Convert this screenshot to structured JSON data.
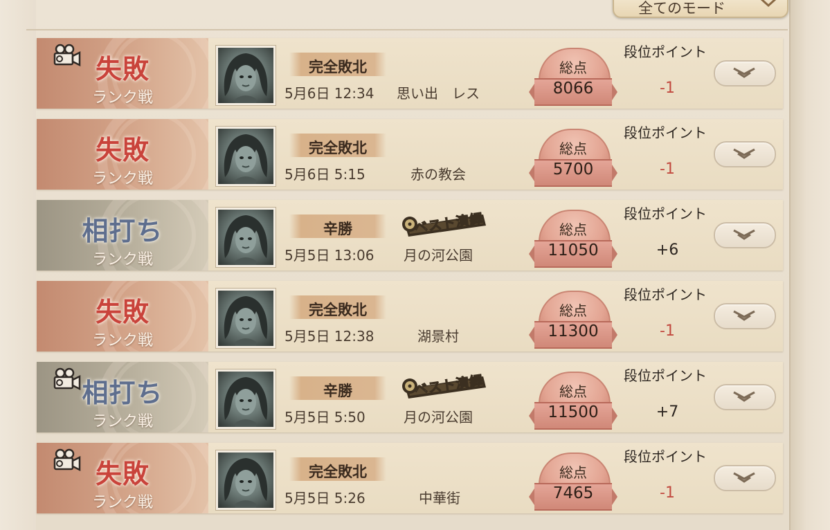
{
  "header": {
    "mode_filter_label": "全てのモード"
  },
  "colors": {
    "lose_text": "#c9433b",
    "draw_text": "#5e6e8e",
    "negative_points": "#c24a40",
    "positive_points": "#2c2520"
  },
  "matches": [
    {
      "result": "失敗",
      "result_type": "lose",
      "mode": "ランク戦",
      "has_recording": true,
      "outcome": "完全敗北",
      "best_play": false,
      "date": "5月6日 12:34",
      "map": "思い出　レス",
      "score_label": "総点",
      "score": "8066",
      "rank_label": "段位ポイント",
      "rank_points": "-1"
    },
    {
      "result": "失敗",
      "result_type": "lose",
      "mode": "ランク戦",
      "has_recording": false,
      "outcome": "完全敗北",
      "best_play": false,
      "date": "5月6日 5:15",
      "map": "赤の教会",
      "score_label": "総点",
      "score": "5700",
      "rank_label": "段位ポイント",
      "rank_points": "-1"
    },
    {
      "result": "相打ち",
      "result_type": "draw",
      "mode": "ランク戦",
      "has_recording": false,
      "outcome": "辛勝",
      "best_play": true,
      "best_play_label": "ベスト演繹",
      "date": "5月5日 13:06",
      "map": "月の河公園",
      "score_label": "総点",
      "score": "11050",
      "rank_label": "段位ポイント",
      "rank_points": "+6"
    },
    {
      "result": "失敗",
      "result_type": "lose",
      "mode": "ランク戦",
      "has_recording": false,
      "outcome": "完全敗北",
      "best_play": false,
      "date": "5月5日 12:38",
      "map": "湖景村",
      "score_label": "総点",
      "score": "11300",
      "rank_label": "段位ポイント",
      "rank_points": "-1"
    },
    {
      "result": "相打ち",
      "result_type": "draw",
      "mode": "ランク戦",
      "has_recording": true,
      "outcome": "辛勝",
      "best_play": true,
      "best_play_label": "ベスト演繹",
      "date": "5月5日 5:50",
      "map": "月の河公園",
      "score_label": "総点",
      "score": "11500",
      "rank_label": "段位ポイント",
      "rank_points": "+7"
    },
    {
      "result": "失敗",
      "result_type": "lose",
      "mode": "ランク戦",
      "has_recording": true,
      "outcome": "完全敗北",
      "best_play": false,
      "date": "5月5日 5:26",
      "map": "中華街",
      "score_label": "総点",
      "score": "7465",
      "rank_label": "段位ポイント",
      "rank_points": "-1"
    }
  ]
}
